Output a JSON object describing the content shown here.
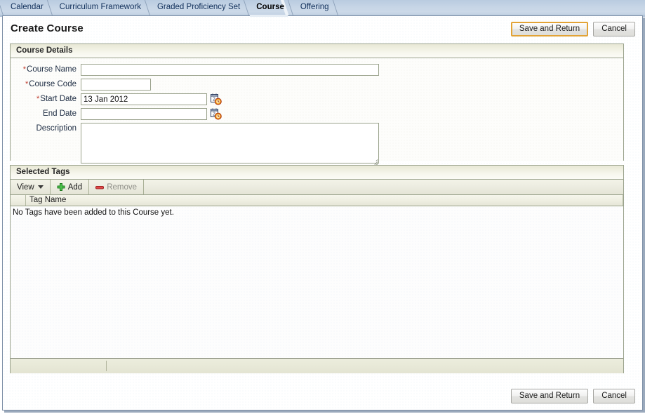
{
  "tabs": [
    {
      "label": "Calendar",
      "active": false
    },
    {
      "label": "Curriculum Framework",
      "active": false
    },
    {
      "label": "Graded Proficiency Set",
      "active": false
    },
    {
      "label": "Course",
      "active": true
    },
    {
      "label": "Offering",
      "active": false
    }
  ],
  "page": {
    "title": "Create Course"
  },
  "header_actions": {
    "save_label": "Save and Return",
    "cancel_label": "Cancel"
  },
  "footer_actions": {
    "save_label": "Save and Return",
    "cancel_label": "Cancel"
  },
  "course_details": {
    "panel_title": "Course Details",
    "fields": {
      "course_name": {
        "label": "Course Name",
        "required": true,
        "value": "",
        "required_marker": "*"
      },
      "course_code": {
        "label": "Course Code",
        "required": true,
        "value": "",
        "required_marker": "*"
      },
      "start_date": {
        "label": "Start Date",
        "required": true,
        "value": "13 Jan 2012",
        "required_marker": "*",
        "picker_icon": "calendar-clock-icon"
      },
      "end_date": {
        "label": "End Date",
        "required": false,
        "value": "",
        "picker_icon": "calendar-clock-icon"
      },
      "description": {
        "label": "Description",
        "required": false,
        "value": ""
      }
    }
  },
  "selected_tags": {
    "panel_title": "Selected Tags",
    "toolbar": {
      "view_label": "View",
      "view_caret_icon": "chevron-down-icon",
      "add_label": "Add",
      "add_icon": "plus-icon",
      "remove_label": "Remove",
      "remove_icon": "minus-icon",
      "remove_disabled": true
    },
    "table": {
      "columns": [
        "Tag Name"
      ],
      "rows": [],
      "empty_message": "No Tags have been added to this Course yet."
    }
  },
  "colors": {
    "accent_focus_border": "#e2a336",
    "required_asterisk": "#c03a2b",
    "panel_border": "#9aa28c",
    "tabstrip": "#c6d5e6",
    "add_icon_green": "#3aa63a",
    "remove_icon_red": "#c62828",
    "window_border": "#7d8fa6"
  }
}
